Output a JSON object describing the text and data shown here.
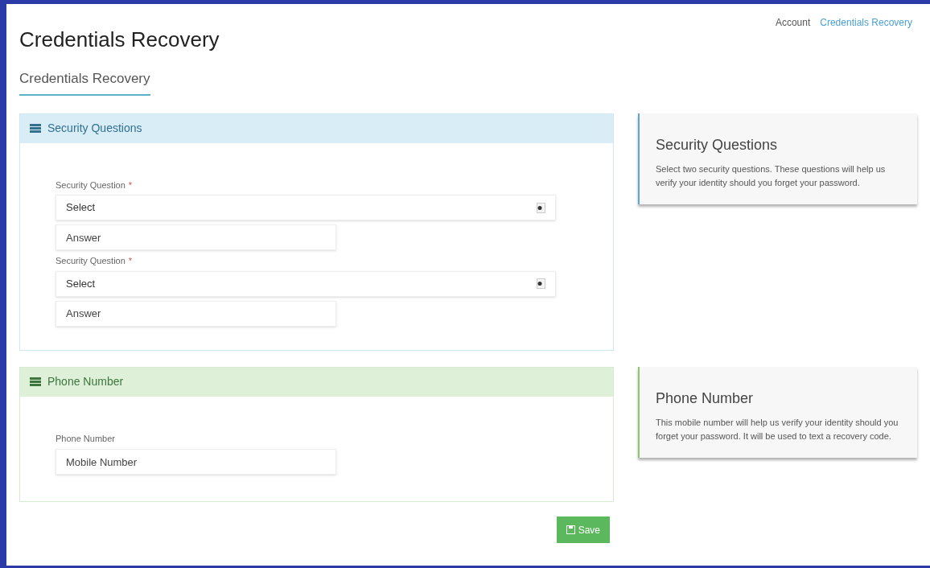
{
  "breadcrumb": [
    {
      "label": "Account",
      "selected": false
    },
    {
      "label": "Credentials Recovery",
      "selected": true
    }
  ],
  "title": "Credentials Recovery",
  "tabs": [
    {
      "label": "Credentials Recovery",
      "selected": true
    }
  ],
  "sections": [
    {
      "kind": "info",
      "title": "Security Questions",
      "fields": [
        {
          "kind": "select",
          "label": "Security Question",
          "required_mark": "*",
          "value": "Select"
        },
        {
          "kind": "text",
          "placeholder": "Answer"
        },
        {
          "kind": "select",
          "label": "Security Question",
          "required_mark": "*",
          "value": "Select"
        },
        {
          "kind": "text",
          "placeholder": "Answer"
        }
      ],
      "help": {
        "title": "Security Questions",
        "text": "Select two security questions. These questions will help us verify your identity should you forget your password."
      }
    },
    {
      "kind": "success",
      "title": "Phone Number",
      "fields": [
        {
          "kind": "label",
          "label": "Phone Number"
        },
        {
          "kind": "text",
          "placeholder": "Mobile Number"
        }
      ],
      "help": {
        "title": "Phone Number",
        "text": "This mobile number will help us verify your identity should you forget your password. It will be used to text a recovery code."
      }
    }
  ],
  "save_button": "Save"
}
